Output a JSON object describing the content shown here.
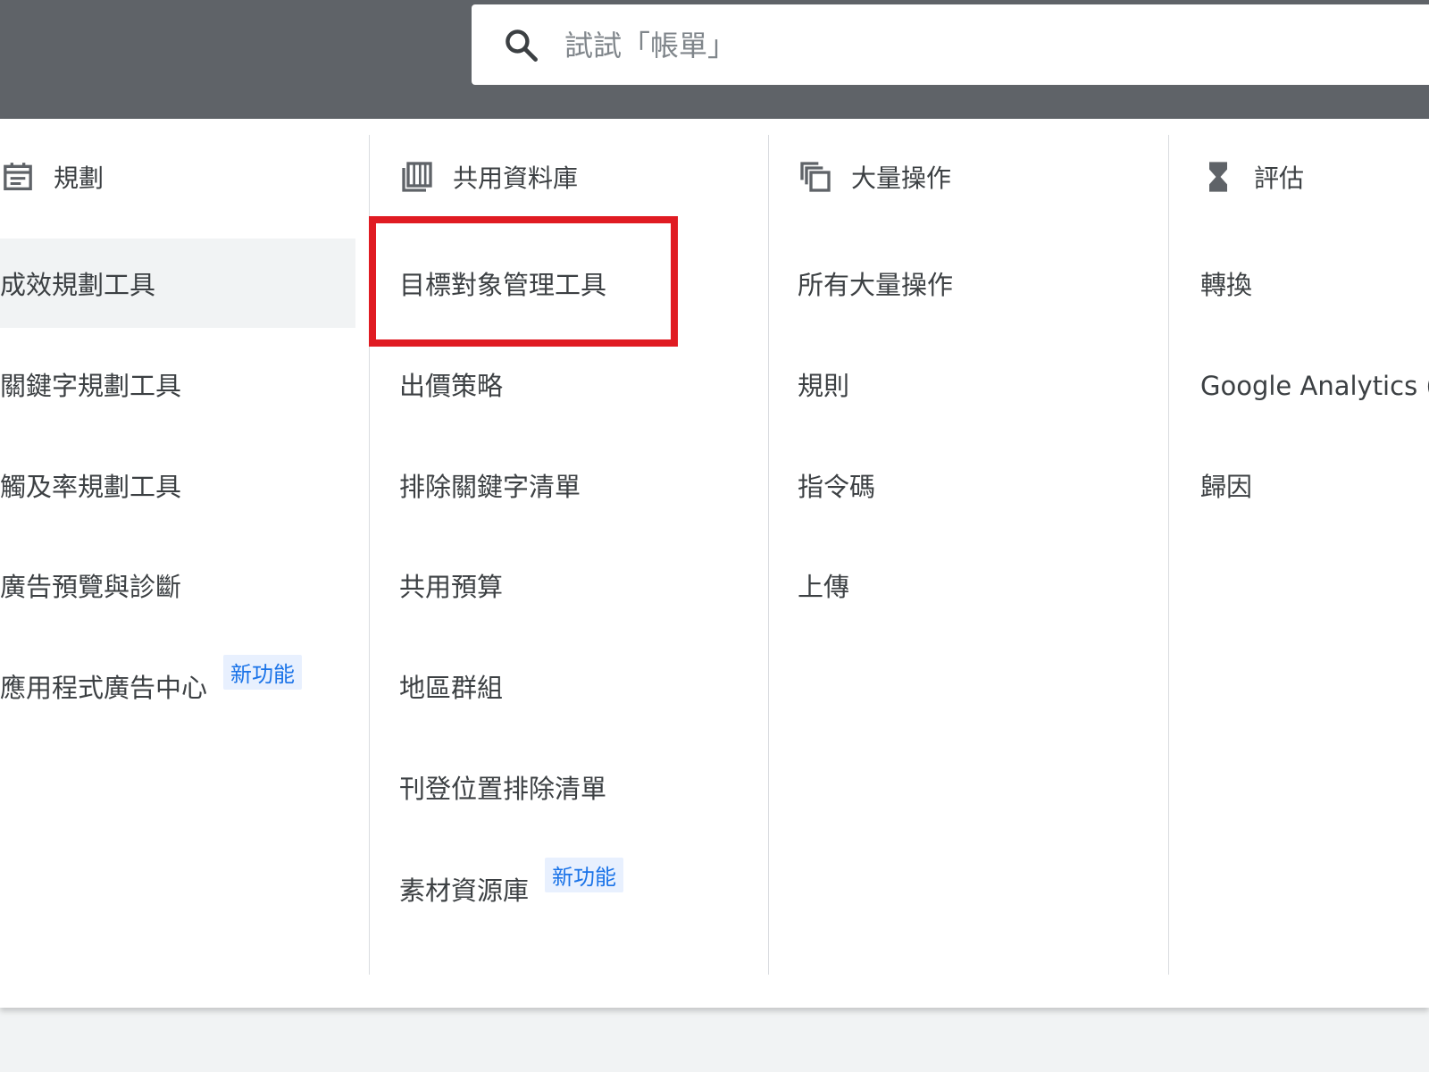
{
  "search": {
    "placeholder": "試試「帳單」"
  },
  "columns": [
    {
      "header": "規劃",
      "icon": "calendar-icon",
      "items": [
        {
          "label": "成效規劃工具",
          "selected": true
        },
        {
          "label": "關鍵字規劃工具"
        },
        {
          "label": "觸及率規劃工具"
        },
        {
          "label": "廣告預覽與診斷"
        },
        {
          "label": "應用程式廣告中心",
          "badge": "新功能"
        }
      ]
    },
    {
      "header": "共用資料庫",
      "icon": "library-icon",
      "items": [
        {
          "label": "目標對象管理工具",
          "highlighted": true
        },
        {
          "label": "出價策略"
        },
        {
          "label": "排除關鍵字清單"
        },
        {
          "label": "共用預算"
        },
        {
          "label": "地區群組"
        },
        {
          "label": "刊登位置排除清單"
        },
        {
          "label": "素材資源庫",
          "badge": "新功能"
        }
      ]
    },
    {
      "header": "大量操作",
      "icon": "copy-icon",
      "items": [
        {
          "label": "所有大量操作"
        },
        {
          "label": "規則"
        },
        {
          "label": "指令碼"
        },
        {
          "label": "上傳"
        }
      ]
    },
    {
      "header": "評估",
      "icon": "hourglass-icon",
      "items": [
        {
          "label": "轉換"
        },
        {
          "label": "Google Analytics (分"
        },
        {
          "label": "歸因"
        }
      ]
    }
  ],
  "colors": {
    "topbar": "#5f6368",
    "highlight": "#e01b22",
    "badge_bg": "#e8f0fe",
    "badge_text": "#1a73e8"
  }
}
